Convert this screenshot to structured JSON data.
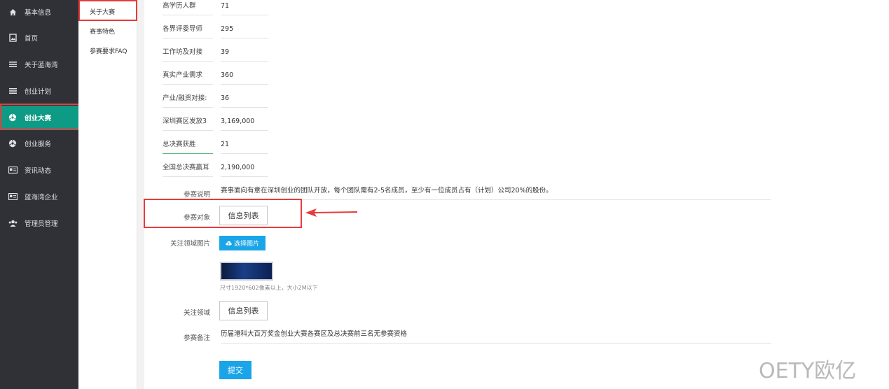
{
  "sidebar": {
    "items": [
      {
        "label": "基本信息",
        "icon": "home-icon"
      },
      {
        "label": "首页",
        "icon": "image-file-icon"
      },
      {
        "label": "关于蓝海湾",
        "icon": "bars-icon"
      },
      {
        "label": "创业计划",
        "icon": "bars-icon"
      },
      {
        "label": "创业大赛",
        "icon": "soccer-ball-icon",
        "active": true
      },
      {
        "label": "创业服务",
        "icon": "soccer-ball-icon"
      },
      {
        "label": "资讯动态",
        "icon": "id-card-icon"
      },
      {
        "label": "蓝海湾企业",
        "icon": "id-card-icon"
      },
      {
        "label": "管理员管理",
        "icon": "users-icon"
      }
    ]
  },
  "subnav": {
    "items": [
      {
        "label": "关于大赛",
        "active": true
      },
      {
        "label": "赛事特色"
      },
      {
        "label": "参赛要求FAQ"
      }
    ]
  },
  "stats": [
    {
      "label": "高学历人群",
      "value": "71"
    },
    {
      "label": "各界评委导师",
      "value": "295"
    },
    {
      "label": "工作坊及对接",
      "value": "39"
    },
    {
      "label": "真实产业需求",
      "value": "360"
    },
    {
      "label": "产业/融资对接:",
      "value": "36"
    },
    {
      "label": "深圳赛区发放3",
      "value": "3,169,000"
    },
    {
      "label": "总决赛获胜",
      "value": "21"
    },
    {
      "label": "全国总决赛赢耳",
      "value": "2,190,000"
    }
  ],
  "form": {
    "desc_label": "参赛说明",
    "desc_value": "赛事面向有意在深圳创业的团队开放，每个团队需有2-5名成员，至少有一位成员占有（计划）公司20%的股份。",
    "target_label": "参赛对象",
    "target_button": "信息列表",
    "image_label": "关注领域图片",
    "choose_image_button": "选择图片",
    "image_hint": "尺寸1920*602像素以上，大小2M以下",
    "field_label": "关注领域",
    "field_button": "信息列表",
    "remark_label": "参赛备注",
    "remark_value": "历届港科大百万奖金创业大赛各赛区及总决赛前三名无参赛资格",
    "submit_button": "提交"
  },
  "colors": {
    "sidebar_bg": "#2f3137",
    "active_green": "#0e9b85",
    "annotation_red": "#e83b3b",
    "button_blue": "#1aa5e8"
  },
  "watermark": "OETY欧亿"
}
